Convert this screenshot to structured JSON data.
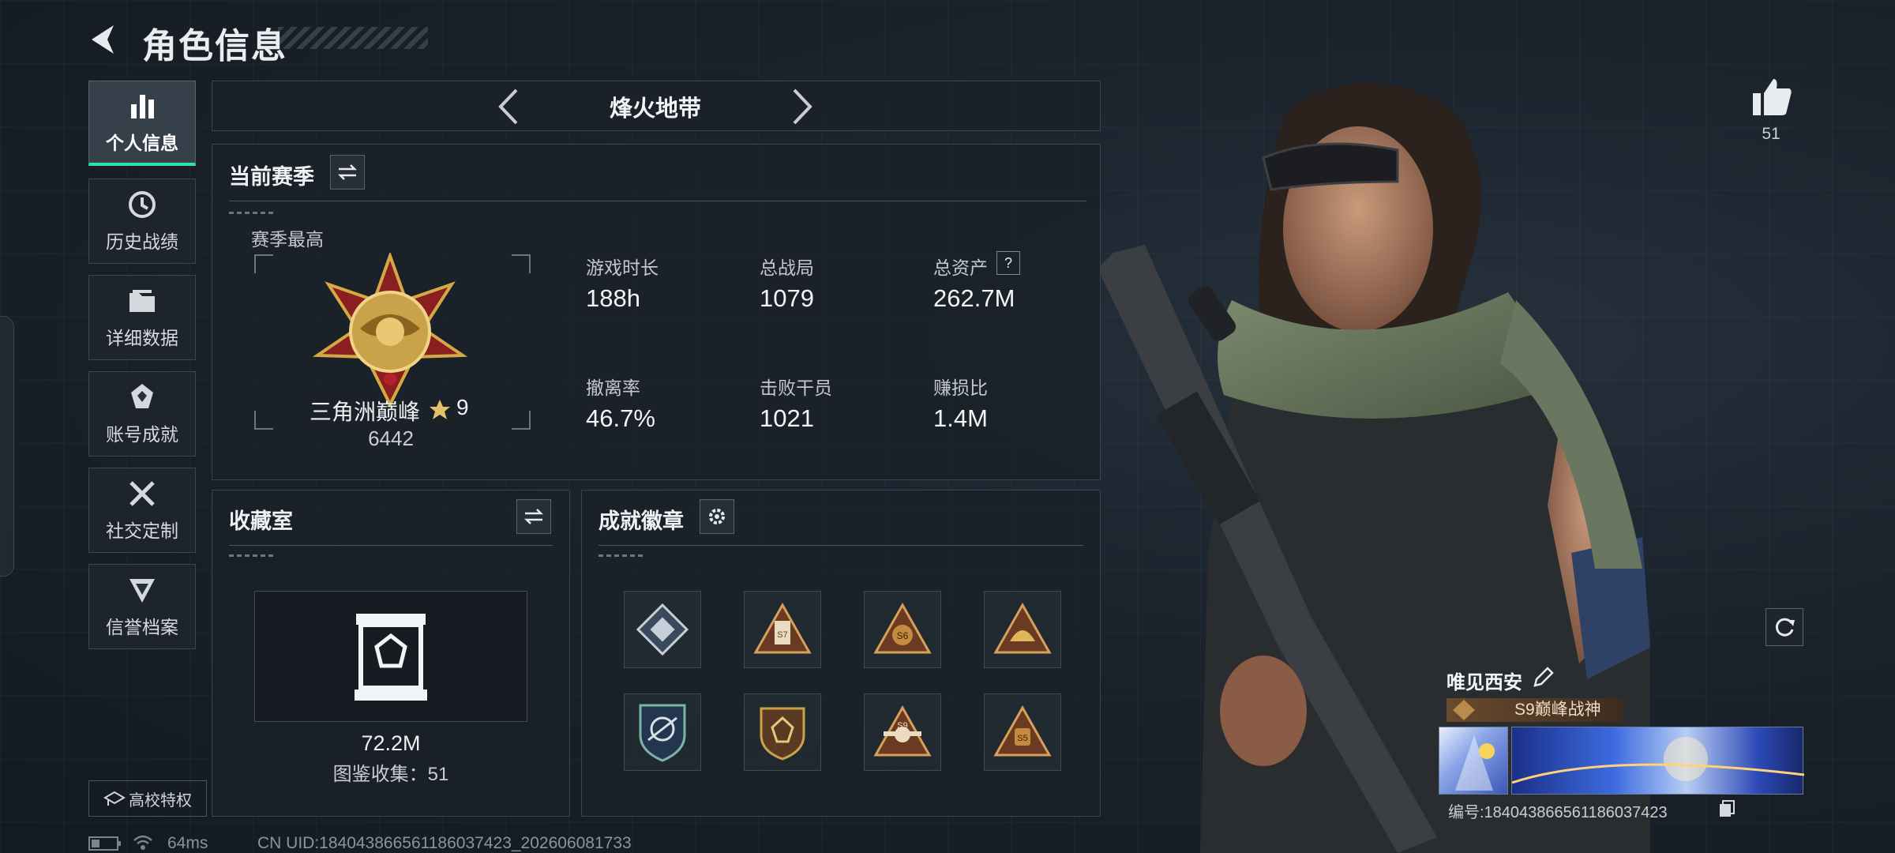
{
  "header": {
    "title": "角色信息"
  },
  "sidebar": {
    "items": [
      {
        "label": "个人信息",
        "icon": "bar-chart-icon",
        "active": true
      },
      {
        "label": "历史战绩",
        "icon": "history-icon"
      },
      {
        "label": "详细数据",
        "icon": "folder-icon"
      },
      {
        "label": "账号成就",
        "icon": "achievement-icon"
      },
      {
        "label": "社交定制",
        "icon": "tools-icon"
      },
      {
        "label": "信誉档案",
        "icon": "shield-icon"
      }
    ],
    "campus_button": "高校特权"
  },
  "mode_tabs": {
    "current": "烽火地带"
  },
  "season": {
    "title": "当前赛季",
    "best_label": "赛季最高",
    "rank_name": "三角洲巅峰",
    "rank_stars": "9",
    "rank_score": "6442",
    "stats": [
      {
        "label": "游戏时长",
        "value": "188h"
      },
      {
        "label": "总战局",
        "value": "1079"
      },
      {
        "label": "总资产",
        "value": "262.7M",
        "help": "?"
      },
      {
        "label": "撤离率",
        "value": "46.7%"
      },
      {
        "label": "击败干员",
        "value": "1021"
      },
      {
        "label": "赚损比",
        "value": "1.4M"
      }
    ]
  },
  "collection": {
    "title": "收藏室",
    "value": "72.2M",
    "catalog_label": "图鉴收集：",
    "catalog_count": "51"
  },
  "achievements": {
    "title": "成就徽章",
    "badges": [
      {
        "icon": "diamond-badge-icon",
        "text": ""
      },
      {
        "icon": "tower-triangle-badge-icon",
        "text": "S7"
      },
      {
        "icon": "s6-triangle-badge-icon",
        "text": "S6"
      },
      {
        "icon": "helmet-triangle-badge-icon",
        "text": ""
      },
      {
        "icon": "shield-wing-badge-icon",
        "text": ""
      },
      {
        "icon": "gem-shield-badge-icon",
        "text": ""
      },
      {
        "icon": "s9-triangle-badge-icon",
        "text": "S9"
      },
      {
        "icon": "s5-triangle-badge-icon",
        "text": "S5"
      }
    ]
  },
  "profile": {
    "likes": "51",
    "name": "唯见西安",
    "title_badge": "S9巅峰战神",
    "id_text": "编号:1840438665611860​37423"
  },
  "status_bar": {
    "ping": "64ms",
    "uid": "CN UID:1840438665611860​37423_202606081733"
  },
  "colors": {
    "accent": "#2fe0a8",
    "gold": "#c9a24a",
    "panel_border": "#3a444e"
  }
}
